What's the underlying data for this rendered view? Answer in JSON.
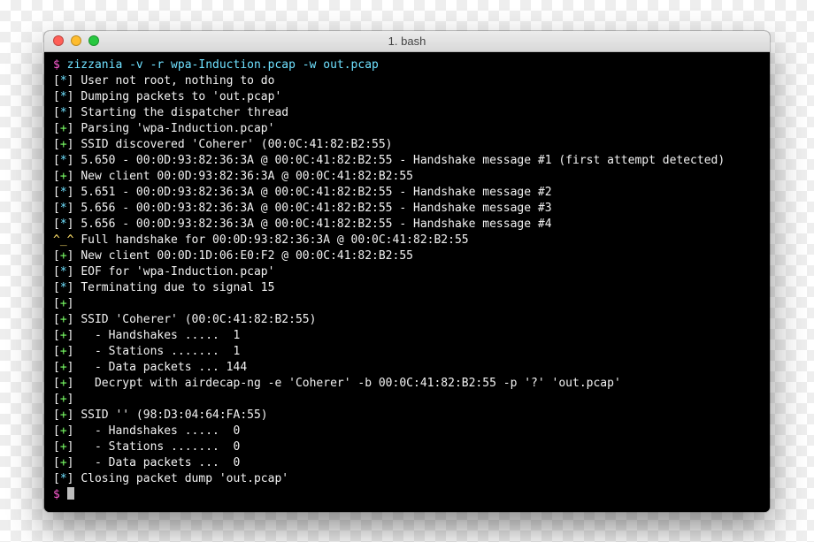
{
  "window": {
    "title": "1. bash"
  },
  "prompt": "$",
  "command": "zizzania -v -r wpa-Induction.pcap -w out.pcap",
  "lines": [
    {
      "tag": "*",
      "text": "User not root, nothing to do"
    },
    {
      "tag": "*",
      "text": "Dumping packets to 'out.pcap'"
    },
    {
      "tag": "*",
      "text": "Starting the dispatcher thread"
    },
    {
      "tag": "+",
      "text": "Parsing 'wpa-Induction.pcap'"
    },
    {
      "tag": "+",
      "text": "SSID discovered 'Coherer' (00:0C:41:82:B2:55)"
    },
    {
      "tag": "*",
      "text": "5.650 - 00:0D:93:82:36:3A @ 00:0C:41:82:B2:55 - Handshake message #1 (first attempt detected)"
    },
    {
      "tag": "+",
      "text": "New client 00:0D:93:82:36:3A @ 00:0C:41:82:B2:55"
    },
    {
      "tag": "*",
      "text": "5.651 - 00:0D:93:82:36:3A @ 00:0C:41:82:B2:55 - Handshake message #2"
    },
    {
      "tag": "*",
      "text": "5.656 - 00:0D:93:82:36:3A @ 00:0C:41:82:B2:55 - Handshake message #3"
    },
    {
      "tag": "*",
      "text": "5.656 - 00:0D:93:82:36:3A @ 00:0C:41:82:B2:55 - Handshake message #4"
    },
    {
      "tag": "^",
      "text": "Full handshake for 00:0D:93:82:36:3A @ 00:0C:41:82:B2:55"
    },
    {
      "tag": "+",
      "text": "New client 00:0D:1D:06:E0:F2 @ 00:0C:41:82:B2:55"
    },
    {
      "tag": "*",
      "text": "EOF for 'wpa-Induction.pcap'"
    },
    {
      "tag": "*",
      "text": "Terminating due to signal 15"
    },
    {
      "tag": "+",
      "text": ""
    },
    {
      "tag": "+",
      "text": "SSID 'Coherer' (00:0C:41:82:B2:55)"
    },
    {
      "tag": "+",
      "text": "  - Handshakes .....  1"
    },
    {
      "tag": "+",
      "text": "  - Stations .......  1"
    },
    {
      "tag": "+",
      "text": "  - Data packets ... 144"
    },
    {
      "tag": "+",
      "text": "  Decrypt with airdecap-ng -e 'Coherer' -b 00:0C:41:82:B2:55 -p '?' 'out.pcap'"
    },
    {
      "tag": "+",
      "text": ""
    },
    {
      "tag": "+",
      "text": "SSID '' (98:D3:04:64:FA:55)"
    },
    {
      "tag": "+",
      "text": "  - Handshakes .....  0"
    },
    {
      "tag": "+",
      "text": "  - Stations .......  0"
    },
    {
      "tag": "+",
      "text": "  - Data packets ...  0"
    },
    {
      "tag": "*",
      "text": "Closing packet dump 'out.pcap'"
    }
  ],
  "tag_glyphs": {
    "*": {
      "open": "[",
      "sym": "*",
      "close": "]",
      "cls": "star"
    },
    "+": {
      "open": "[",
      "sym": "+",
      "close": "]",
      "cls": "plus"
    },
    "^": {
      "open": "",
      "sym": "^_^",
      "close": "",
      "cls": "face"
    }
  }
}
